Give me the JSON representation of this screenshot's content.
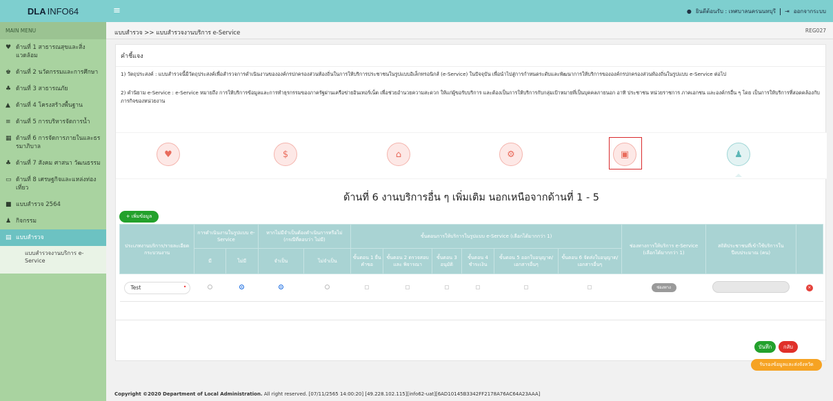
{
  "app": {
    "logo_bold": "DLA",
    "logo_rest": "INFO64"
  },
  "header": {
    "user_text": "ยินดีต้อนรับ : เทศบาลนครนนทบุรี",
    "logout_label": "ออกจากระบบ"
  },
  "sidebar": {
    "header": "MAIN MENU",
    "items": [
      {
        "label": "ด้านที่ 1 สาธารณสุขและสิ่งแวดล้อม",
        "icon": "heart-icon"
      },
      {
        "label": "ด้านที่ 2 นวัตกรรมและการศึกษา",
        "icon": "education-icon"
      },
      {
        "label": "ด้านที่ 3 สาธารณภัย",
        "icon": "disaster-icon"
      },
      {
        "label": "ด้านที่ 4 โครงสร้างพื้นฐาน",
        "icon": "road-icon"
      },
      {
        "label": "ด้านที่ 5 การบริหารจัดการน้ำ",
        "icon": "water-icon"
      },
      {
        "label": "ด้านที่ 6 การจัดการภายในและธรรมาภิบาล",
        "icon": "governance-icon"
      },
      {
        "label": "ด้านที่ 7 สังคม ศาสนา วัฒนธรรม",
        "icon": "people-icon"
      },
      {
        "label": "ด้านที่ 8 เศรษฐกิจและแหล่งท่องเที่ยว",
        "icon": "economy-icon"
      },
      {
        "label": "แบบสำรวจ 2564",
        "icon": "survey-icon"
      },
      {
        "label": "กิจกรรม",
        "icon": "user-icon"
      },
      {
        "label": "แบบสำรวจ",
        "icon": "form-icon"
      }
    ],
    "submenu_item": "แบบสำรวจงานบริการ e-Service"
  },
  "breadcrumb": {
    "text": "แบบสำรวจ >> แบบสำรวจงานบริการ e-Service",
    "code": "REG027"
  },
  "description": {
    "title": "คำชี้แจง",
    "line1": "1) วัตถุประสงค์ : แบบสำรวจนี้มีวัตถุประสงค์เพื่อสำรวจการดำเนินงานขององค์กรปกครองส่วนท้องถิ่นในการให้บริการประชาชนในรูปแบบอิเล็กทรอนิกส์ (e-Service) ในปัจจุบัน เพื่อนำไปสู่การกำหนดระดับและพัฒนาการให้บริการขององค์กรปกครองส่วนท้องถิ่นในรูปแบบ e-Service ต่อไป",
    "line2": "2) คำนิยาม e-Service : e-Service หมายถึง การให้บริการข้อมูลและการทำธุรกรรมของภาครัฐผ่านเครือข่ายอินเทอร์เน็ต เพื่อช่วยอำนวยความสะดวก ให้แก่ผู้ขอรับบริการ และต้องเป็นการให้บริการกับกลุ่มเป้าหมายที่เป็นบุคคลภายนอก อาทิ ประชาชน หน่วยราชการ ภาคเอกชน และองค์กรอื่น ๆ โดย เป็นการให้บริการที่สอดคล้องกับภารกิจของหน่วยงาน"
  },
  "steps": [
    {
      "icon": "health-icon",
      "glyph": "♥"
    },
    {
      "icon": "money-icon",
      "glyph": "$"
    },
    {
      "icon": "home-icon",
      "glyph": "⌂"
    },
    {
      "icon": "settings-icon",
      "glyph": "⚙"
    },
    {
      "icon": "briefcase-icon",
      "glyph": "▣"
    },
    {
      "icon": "person-icon",
      "glyph": "♟"
    }
  ],
  "section_title": "ด้านที่ 6 งานบริการอื่น ๆ เพิ่มเติม นอกเหนือจากด้านที่ 1 - 5",
  "add_button": "+ เพิ่มข้อมูล",
  "table": {
    "h_type": "ประเภทงานบริการ/รายละเอียดกระบวนงาน",
    "h_operate": "การดำเนินงานในรูปแบบ e-Service",
    "h_ifnot": "หากไม่มีจำเป็นต้องดำเนินการหรือไม่ (กรณีที่ตอบว่า ไม่มี)",
    "h_steps": "ขั้นตอนการให้บริการในรูปแบบ e-Service (เลือกได้มากกว่า 1)",
    "h_channel": "ช่องทางการให้บริการ e-Service (เลือกได้มากกว่า 1)",
    "h_stats": "สถิติประชาชนที่เข้าใช้บริการในปีงบประมาณ (คน)",
    "h_have": "มี",
    "h_nothave": "ไม่มี",
    "h_need": "จำเป็น",
    "h_noneed": "ไม่จำเป็น",
    "h_s1": "ขั้นตอน 1 ยื่นคำขอ",
    "h_s2": "ขั้นตอน 2 ตรวจสอบและ พิจารณา",
    "h_s3": "ขั้นตอน 3 อนุมัติ",
    "h_s4": "ขั้นตอน 4 ชำระเงิน",
    "h_s5": "ขั้นตอน 5 ออกใบอนุญาต/เอกสารอื่นๆ",
    "h_s6": "ขั้นตอน 6 จัดส่งใบอนุญาต/เอกสารอื่นๆ",
    "row": {
      "value": "Test",
      "channel_btn": "ช่องทาง"
    }
  },
  "buttons": {
    "save": "บันทึก",
    "back": "กลับ",
    "confirm": "รับรองข้อมูลและส่งจังหวัด"
  },
  "footer": {
    "copyright": "Copyright ©2020 Department of Local Administration.",
    "rest": " All right reserved. [07/11/2565 14:00:20] [49.228.102.115][info62-uat][6AD10145B3342FF2178A76AC64A23AAA]"
  }
}
